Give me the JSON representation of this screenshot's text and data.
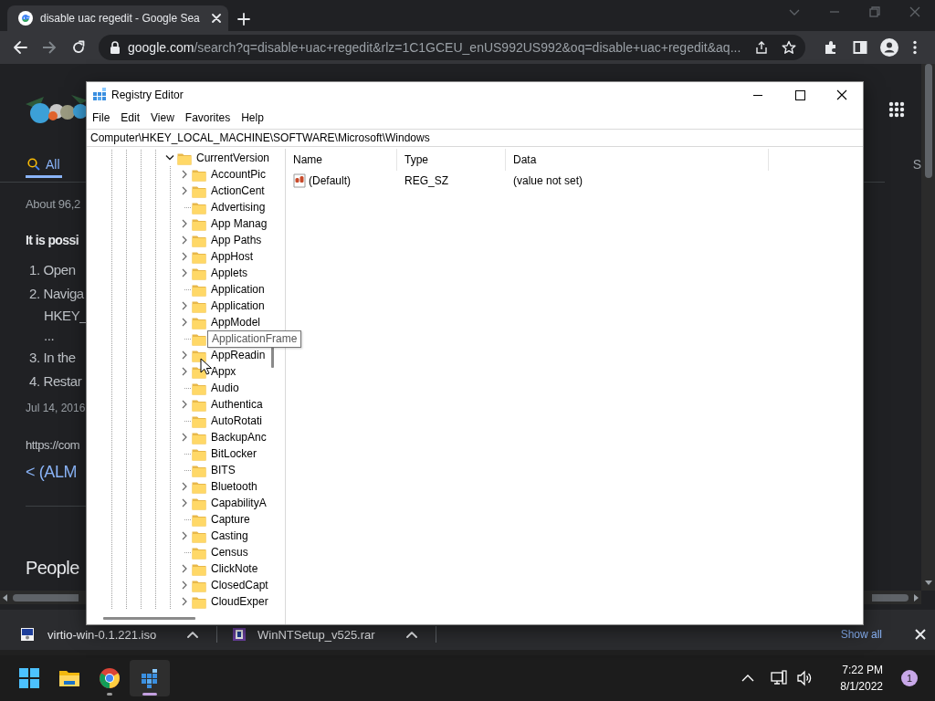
{
  "browser": {
    "tab": {
      "title": "disable uac regedit - Google Sea",
      "selected": true
    },
    "address": "google.com/search?q=disable+uac+regedit&rlz=1C1GCEU_enUS992US992&oq=disable+uac+regedit&aq...",
    "page": {
      "nav_tab": {
        "label": "All",
        "selected": true
      },
      "right_text": "S",
      "result_stats": "About 96,2",
      "snippet_heading": "It is possi",
      "steps": [
        {
          "text": "1. Open"
        },
        {
          "text": "2. Naviga",
          "lines": [
            "HKEY_",
            "..."
          ]
        },
        {
          "text": "3. In the"
        },
        {
          "text": "4. Restar"
        }
      ],
      "date": "Jul 14, 2016",
      "url": "https://com",
      "link": "< (ALM",
      "section_heading": "People"
    }
  },
  "registry_editor": {
    "title": "Registry Editor",
    "menu": [
      "File",
      "Edit",
      "View",
      "Favorites",
      "Help"
    ],
    "address": "Computer\\HKEY_LOCAL_MACHINE\\SOFTWARE\\Microsoft\\Windows",
    "tree": [
      {
        "label": "CurrentVersion",
        "expanded": true,
        "children": [
          {
            "label": "AccountPic",
            "has_subkeys": true
          },
          {
            "label": "ActionCent",
            "has_subkeys": true
          },
          {
            "label": "Advertising",
            "has_subkeys": false
          },
          {
            "label": "App Manag",
            "has_subkeys": true
          },
          {
            "label": "App Paths",
            "has_subkeys": true
          },
          {
            "label": "AppHost",
            "has_subkeys": true
          },
          {
            "label": "Applets",
            "has_subkeys": true
          },
          {
            "label": "Application",
            "has_subkeys": false
          },
          {
            "label": "Application",
            "has_subkeys": true
          },
          {
            "label": "AppModel",
            "has_subkeys": true
          },
          {
            "label": "ApplicationFrame",
            "has_subkeys": false,
            "tooltip": true
          },
          {
            "label": "AppReadin",
            "has_subkeys": true
          },
          {
            "label": "Appx",
            "has_subkeys": true
          },
          {
            "label": "Audio",
            "has_subkeys": false
          },
          {
            "label": "Authentica",
            "has_subkeys": true
          },
          {
            "label": "AutoRotati",
            "has_subkeys": false
          },
          {
            "label": "BackupAnc",
            "has_subkeys": true
          },
          {
            "label": "BitLocker",
            "has_subkeys": false
          },
          {
            "label": "BITS",
            "has_subkeys": false
          },
          {
            "label": "Bluetooth",
            "has_subkeys": true
          },
          {
            "label": "CapabilityA",
            "has_subkeys": true
          },
          {
            "label": "Capture",
            "has_subkeys": false
          },
          {
            "label": "Casting",
            "has_subkeys": true
          },
          {
            "label": "Census",
            "has_subkeys": false
          },
          {
            "label": "ClickNote",
            "has_subkeys": true
          },
          {
            "label": "ClosedCapt",
            "has_subkeys": true
          },
          {
            "label": "CloudExper",
            "has_subkeys": true
          }
        ]
      }
    ],
    "columns": [
      "Name",
      "Type",
      "Data"
    ],
    "values": [
      {
        "name": "(Default)",
        "type": "REG_SZ",
        "data": "(value not set)",
        "kind": "string"
      }
    ]
  },
  "downloads": {
    "items": [
      {
        "name": "virtio-win-0.1.221.iso",
        "kind": "iso"
      },
      {
        "name": "WinNTSetup_v525.rar",
        "kind": "rar"
      }
    ],
    "show_all": "Show all"
  },
  "taskbar": {
    "apps": [
      {
        "kind": "start",
        "running": false,
        "active": false
      },
      {
        "kind": "explorer",
        "running": false,
        "active": false
      },
      {
        "kind": "chrome",
        "running": true,
        "active": false
      },
      {
        "kind": "regedit",
        "running": true,
        "active": true
      }
    ],
    "time": "7:22 PM",
    "date": "8/1/2022",
    "notifications": "1"
  }
}
